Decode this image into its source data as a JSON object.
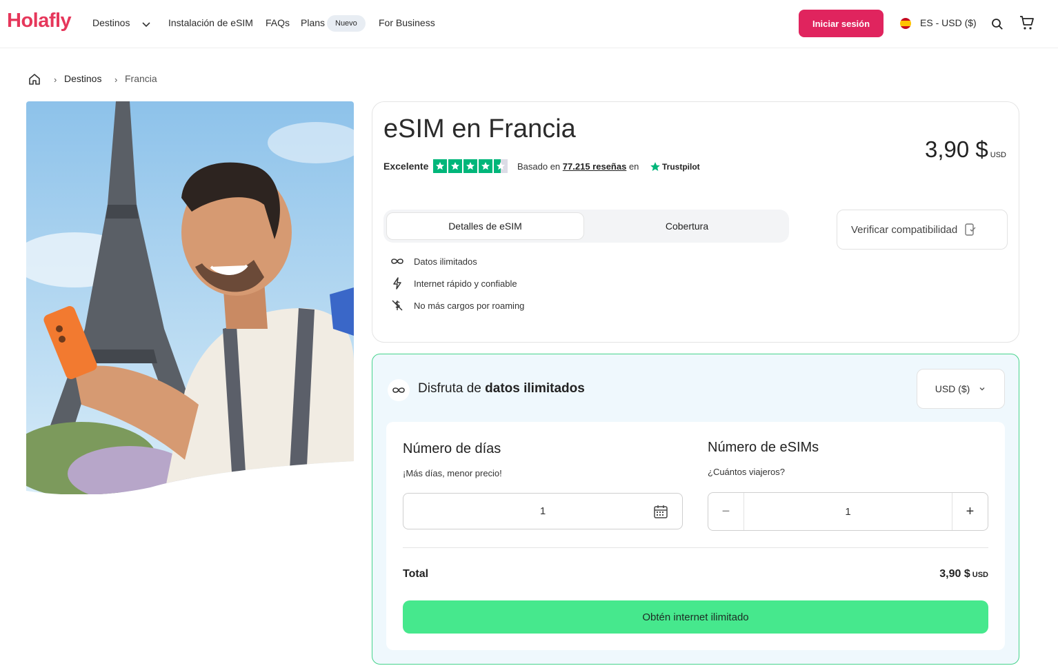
{
  "brand": {
    "name": "Holafly",
    "accent": "#e0245e",
    "cta_color": "#46e88d"
  },
  "nav": {
    "destinos": "Destinos",
    "instalacion": "Instalación de eSIM",
    "faqs": "FAQs",
    "plans": "Plans",
    "plans_badge": "Nuevo",
    "business": "For Business",
    "login": "Iniciar sesión",
    "locale": "ES - USD ($)"
  },
  "breadcrumb": {
    "items": [
      "Destinos",
      "Francia"
    ]
  },
  "product": {
    "title": "eSIM en Francia",
    "rating_label": "Excelente",
    "rating_stars": 4.5,
    "reviews_prefix": "Basado en",
    "reviews_count": "77.215 reseñas",
    "reviews_suffix": "en",
    "trustpilot": "Trustpilot",
    "price": "3,90 $",
    "price_currency": "USD",
    "tabs": [
      "Detalles de eSIM",
      "Cobertura"
    ],
    "verify": "Verificar compatibilidad",
    "features": [
      {
        "icon": "infinity-icon",
        "text": "Datos ilimitados"
      },
      {
        "icon": "lightning-icon",
        "text": "Internet rápido y confiable"
      },
      {
        "icon": "no-roaming-icon",
        "text": "No más cargos por roaming"
      }
    ]
  },
  "purchase": {
    "title_prefix": "Disfruta de",
    "title_bold": "datos ilimitados",
    "currency_select": "USD ($)",
    "days_title": "Número de días",
    "days_subtitle": "¡Más días, menor precio!",
    "days_value": "1",
    "esims_title": "Número de eSIMs",
    "esims_subtitle": "¿Cuántos viajeros?",
    "esims_value": "1",
    "minus": "−",
    "plus": "+",
    "total_label": "Total",
    "total_value": "3,90 $",
    "total_currency": "USD",
    "cta": "Obtén internet ilimitado"
  }
}
